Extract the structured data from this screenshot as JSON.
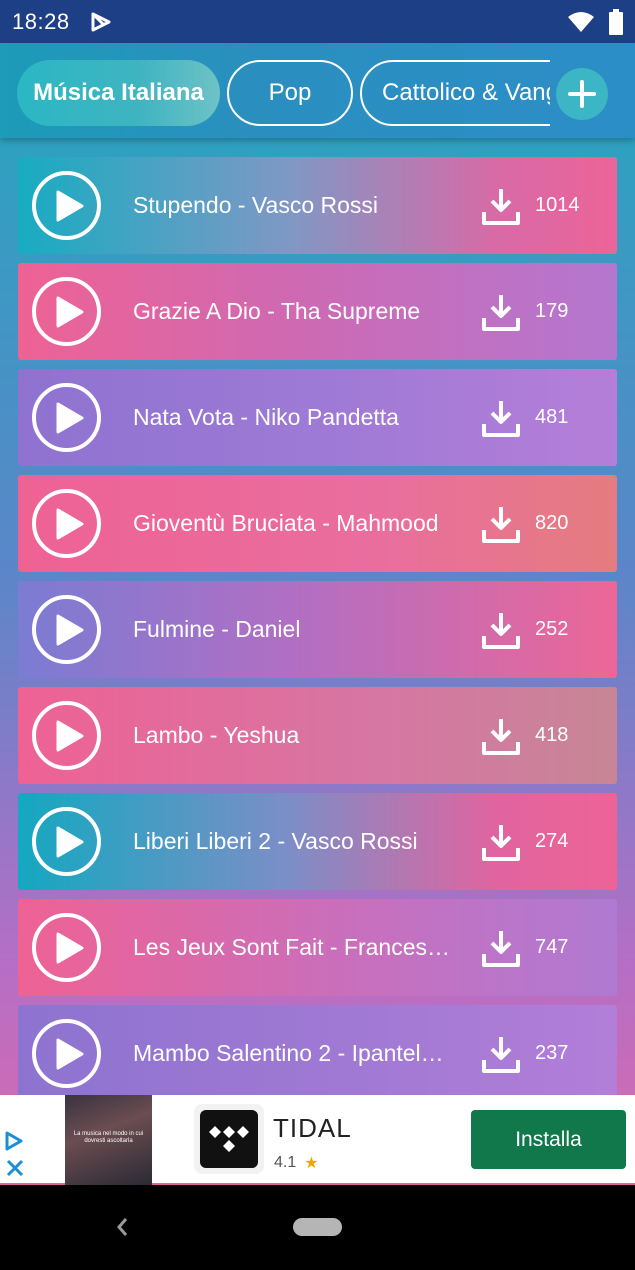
{
  "status_bar": {
    "time": "18:28",
    "app_icon": "play-store-notification-icon",
    "wifi_icon": "wifi-icon",
    "battery_icon": "battery-icon"
  },
  "tabs": [
    {
      "label": "Música Italiana",
      "active": true
    },
    {
      "label": "Pop",
      "active": false
    },
    {
      "label": "Cattolico & Vangelo",
      "active": false
    }
  ],
  "add_tab_icon": "plus-icon",
  "songs": [
    {
      "title": "Stupendo - Vasco Rossi",
      "downloads": "1014"
    },
    {
      "title": "Grazie A Dio - Tha Supreme",
      "downloads": "179"
    },
    {
      "title": "Nata Vota - Niko Pandetta",
      "downloads": "481"
    },
    {
      "title": "Gioventù Bruciata - Mahmood",
      "downloads": "820"
    },
    {
      "title": "Fulmine - Daniel",
      "downloads": "252"
    },
    {
      "title": "Lambo - Yeshua",
      "downloads": "418"
    },
    {
      "title": "Liberi Liberi 2 - Vasco Rossi",
      "downloads": "274"
    },
    {
      "title": "Les Jeux Sont Fait - Frances…",
      "downloads": "747"
    },
    {
      "title": "Mambo Salentino 2 - Ipantel…",
      "downloads": "237"
    }
  ],
  "ad": {
    "image_caption": "La musica nel modo in cui dovresti ascoltarla",
    "app_name": "TIDAL",
    "rating": "4.1",
    "install_label": "Installa",
    "brand_color": "#10784b"
  },
  "colors": {
    "status_bar": "#1d3f86",
    "accent_teal": "#17acc1",
    "accent_pink": "#ee6294"
  }
}
